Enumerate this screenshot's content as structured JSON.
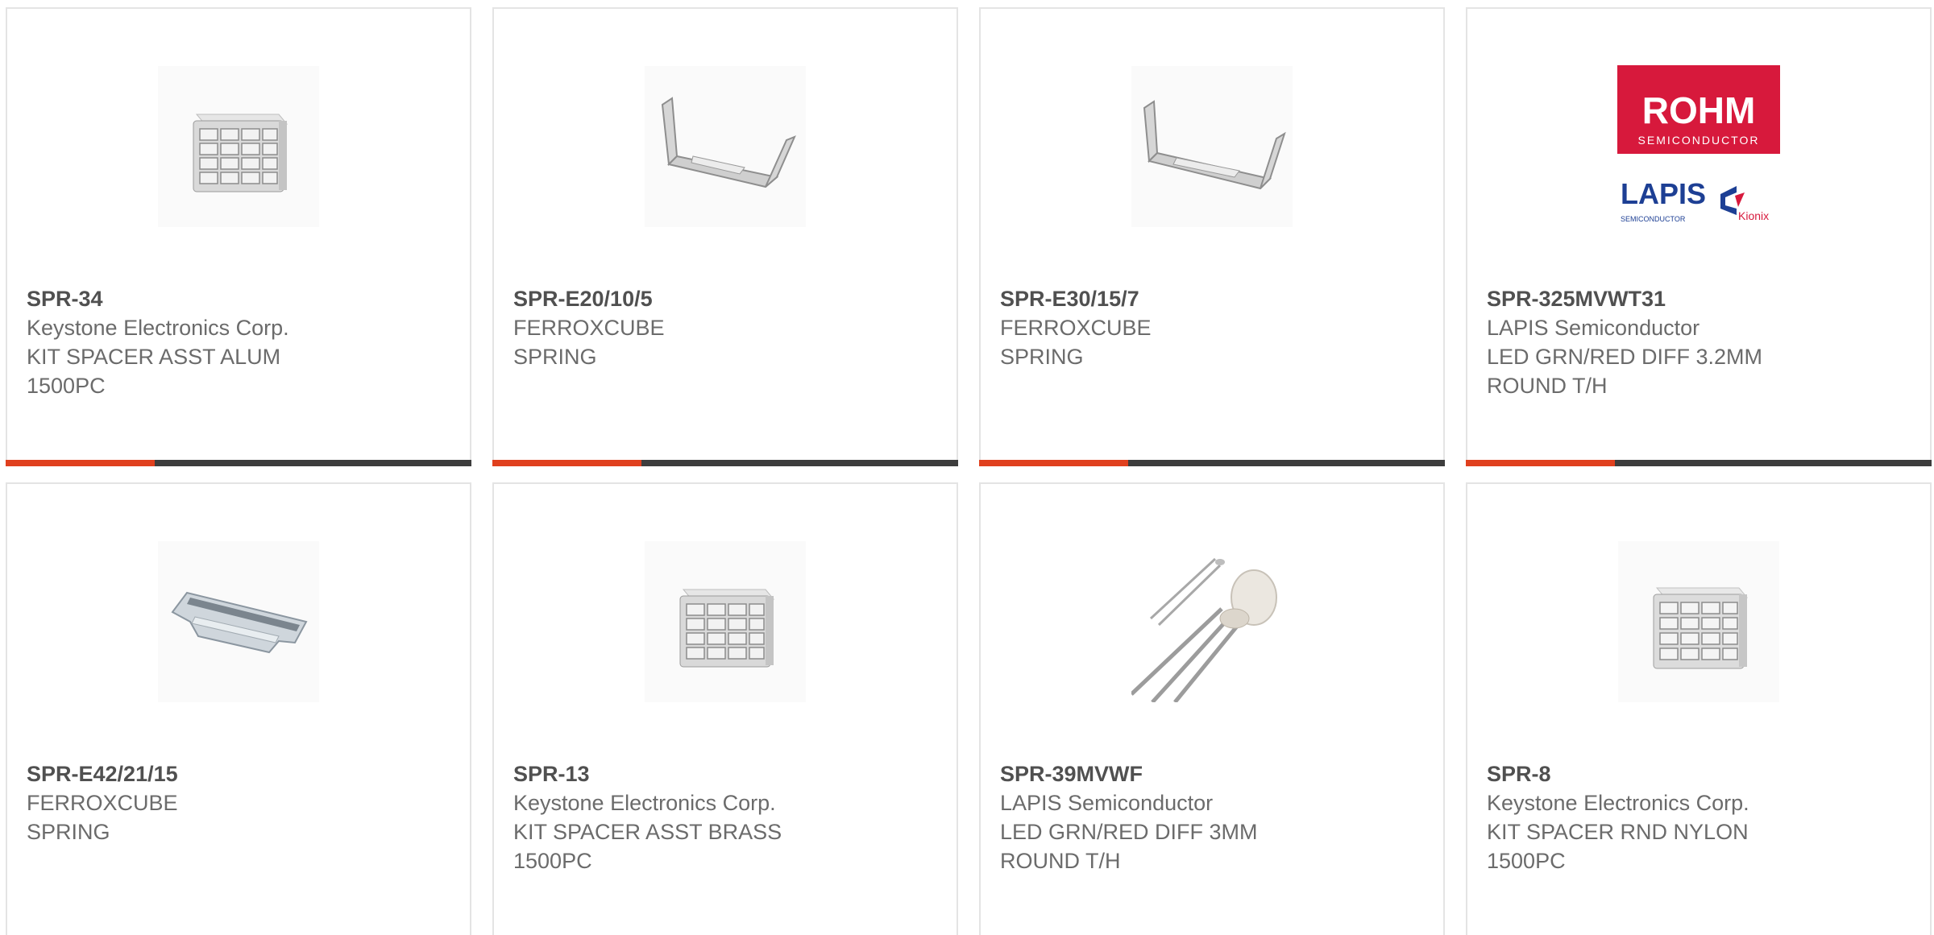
{
  "products": [
    {
      "part": "SPR-34",
      "manufacturer": "Keystone Electronics Corp.",
      "desc1": "KIT SPACER ASST ALUM",
      "desc2": "1500PC",
      "image": "spacer-kit-icon",
      "progress": 0.32
    },
    {
      "part": "SPR-E20/10/5",
      "manufacturer": "FERROXCUBE",
      "desc1": "SPRING",
      "desc2": "",
      "image": "spring-clip-icon",
      "progress": 0.32
    },
    {
      "part": "SPR-E30/15/7",
      "manufacturer": "FERROXCUBE",
      "desc1": "SPRING",
      "desc2": "",
      "image": "spring-clip-icon",
      "progress": 0.32
    },
    {
      "part": "SPR-325MVWT31",
      "manufacturer": "LAPIS Semiconductor",
      "desc1": "LED GRN/RED DIFF 3.2MM",
      "desc2": "ROUND T/H",
      "image": "rohm-logo",
      "progress": 0.32,
      "logo_text": {
        "rohm": "ROHM",
        "semiconductor": "SEMICONDUCTOR",
        "lapis": "LAPIS",
        "lapis_sub": "SEMICONDUCTOR",
        "kionix": "Kionix"
      }
    },
    {
      "part": "SPR-E42/21/15",
      "manufacturer": "FERROXCUBE",
      "desc1": "SPRING",
      "desc2": "",
      "image": "spring-plate-icon"
    },
    {
      "part": "SPR-13",
      "manufacturer": "Keystone Electronics Corp.",
      "desc1": "KIT SPACER ASST BRASS",
      "desc2": "1500PC",
      "image": "spacer-kit-icon"
    },
    {
      "part": "SPR-39MVWF",
      "manufacturer": "LAPIS Semiconductor",
      "desc1": "LED GRN/RED DIFF 3MM",
      "desc2": "ROUND T/H",
      "image": "led-icon"
    },
    {
      "part": "SPR-8",
      "manufacturer": "Keystone Electronics Corp.",
      "desc1": "KIT SPACER RND NYLON",
      "desc2": "1500PC",
      "image": "spacer-kit-icon"
    }
  ],
  "colors": {
    "accent": "#e0401e",
    "bar": "#3d3d3d",
    "part_text": "#505050",
    "body_text": "#6b6b6b",
    "border": "#e4e4e4",
    "rohm_red": "#d7193c",
    "lapis_blue": "#1d3f94"
  }
}
